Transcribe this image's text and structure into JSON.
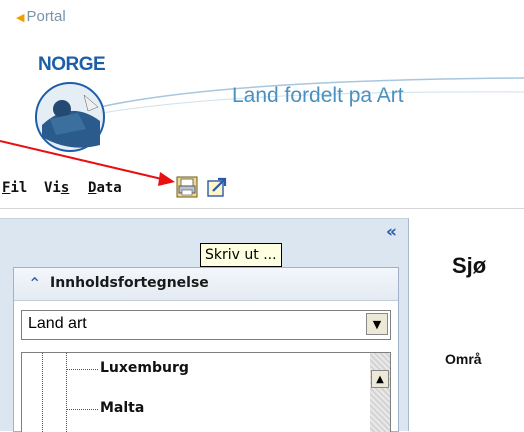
{
  "portal": {
    "label": "Portal"
  },
  "logo": {
    "text": "NORGE"
  },
  "banner": {
    "title": "Land fordelt pa Art"
  },
  "menu": {
    "fil": {
      "u": "F",
      "rest": "il"
    },
    "vis": {
      "pre": "Vi",
      "u": "s"
    },
    "data": {
      "u": "D",
      "rest": "ata"
    }
  },
  "toolbar": {
    "print_icon": "printer-icon",
    "export_icon": "export-icon"
  },
  "tooltip": {
    "text": "Skriv ut ..."
  },
  "panel": {
    "collapse_glyph": "«",
    "toc_chevron": "≈",
    "toc_title": "Innholdsfortegnelse",
    "select_value": "Land art",
    "tree_items": [
      "Luxemburg",
      "Malta"
    ]
  },
  "main": {
    "title_partial": "Sjø",
    "label_partial": "Områ"
  },
  "colors": {
    "annotation_arrow": "#e81010",
    "panel_bg": "#dce6f1",
    "accent": "#2c5da8"
  }
}
